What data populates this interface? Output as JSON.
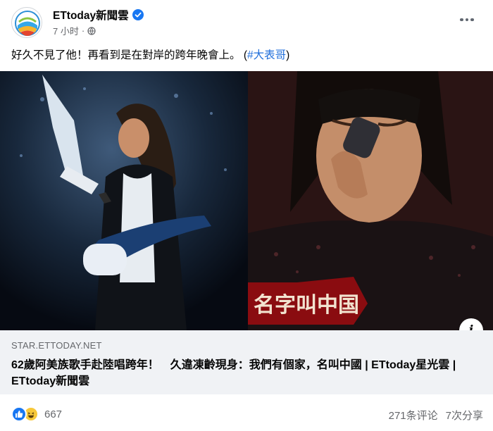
{
  "post": {
    "page_name": "ETtoday新聞雲",
    "time": "7 小时",
    "separator": "·",
    "caption_text": "好久不見了他！再看到是在對岸的跨年晚會上。 ",
    "caption_hashtag_open": "(",
    "caption_hashtag": "#大表哥",
    "caption_hashtag_close": ")"
  },
  "media": {
    "overlay_text": "名字叫中国",
    "info_label": "i"
  },
  "link_preview": {
    "domain": "STAR.ETTODAY.NET",
    "title": "62歲阿美族歌手赴陸唱跨年！　久違凍齡現身：我們有個家，名叫中國 | ETtoday星光雲 | ETtoday新聞雲"
  },
  "footer": {
    "reaction_count": "667",
    "comments": "271条评论",
    "shares": "7次分享"
  },
  "icons": {
    "verified": "verified-badge-icon",
    "privacy": "globe-icon",
    "more": "more-options-icon",
    "like": "like-reaction-icon",
    "haha": "haha-reaction-icon"
  },
  "colors": {
    "brand_blue": "#1877f2",
    "hashtag": "#216fdb",
    "muted_text": "#65676b",
    "preview_bg": "#f0f2f5"
  }
}
